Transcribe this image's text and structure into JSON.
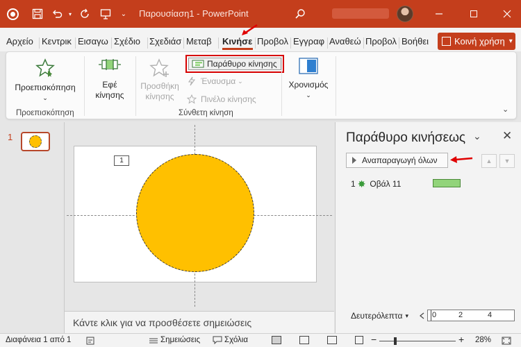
{
  "titlebar": {
    "title": "Παρουσίαση1 - PowerPoint",
    "icons": [
      "powerpoint-logo-icon",
      "save-icon",
      "undo-icon",
      "redo-icon",
      "present-icon",
      "search-icon",
      "minimize-icon",
      "maximize-icon",
      "close-icon"
    ],
    "accent": "#c43e1c"
  },
  "tabs": [
    "Αρχείο",
    "Κεντρικ",
    "Εισαγω",
    "Σχέδιο",
    "Σχεδιάσ",
    "Μεταβ",
    "Κινήσε",
    "Προβολ",
    "Εγγραφ",
    "Αναθεώ",
    "Προβολ",
    "Βοήθει"
  ],
  "active_tab": "Κινήσε",
  "share": {
    "label": "Κοινή χρήση"
  },
  "ribbon": {
    "preview_label": "Προεπισκόπηση",
    "preview_group": "Προεπισκόπηση",
    "effects_label": "Εφέ\nκίνησης",
    "effects_line1": "Εφέ",
    "effects_line2": "κίνησης",
    "add_anim_line1": "Προσθήκη",
    "add_anim_line2": "κίνησης",
    "animation_pane": "Παράθυρο κίνησης",
    "trigger": "Έναυσμα",
    "painter": "Πινέλο κίνησης",
    "advanced_group": "Σύνθετη κίνηση",
    "timing_label": "Χρονισμός"
  },
  "slides": {
    "thumb_number": "1"
  },
  "slide": {
    "anim_tag": "1",
    "shape_color": "#ffc000"
  },
  "notes": {
    "placeholder": "Κάντε κλικ για να προσθέσετε σημειώσεις"
  },
  "anim_pane": {
    "title": "Παράθυρο κινήσεως",
    "play_all": "Αναπαραγωγή όλων",
    "items": [
      {
        "index": "1",
        "name": "Οβάλ 11",
        "bar_color": "#92d47a"
      }
    ],
    "timeline_label": "Δευτερόλεπτα",
    "scale": [
      "0",
      "2",
      "4"
    ]
  },
  "statusbar": {
    "slide_info": "Διαφάνεια 1 από 1",
    "notes": "Σημειώσεις",
    "comments": "Σχόλια",
    "zoom": "28%"
  }
}
